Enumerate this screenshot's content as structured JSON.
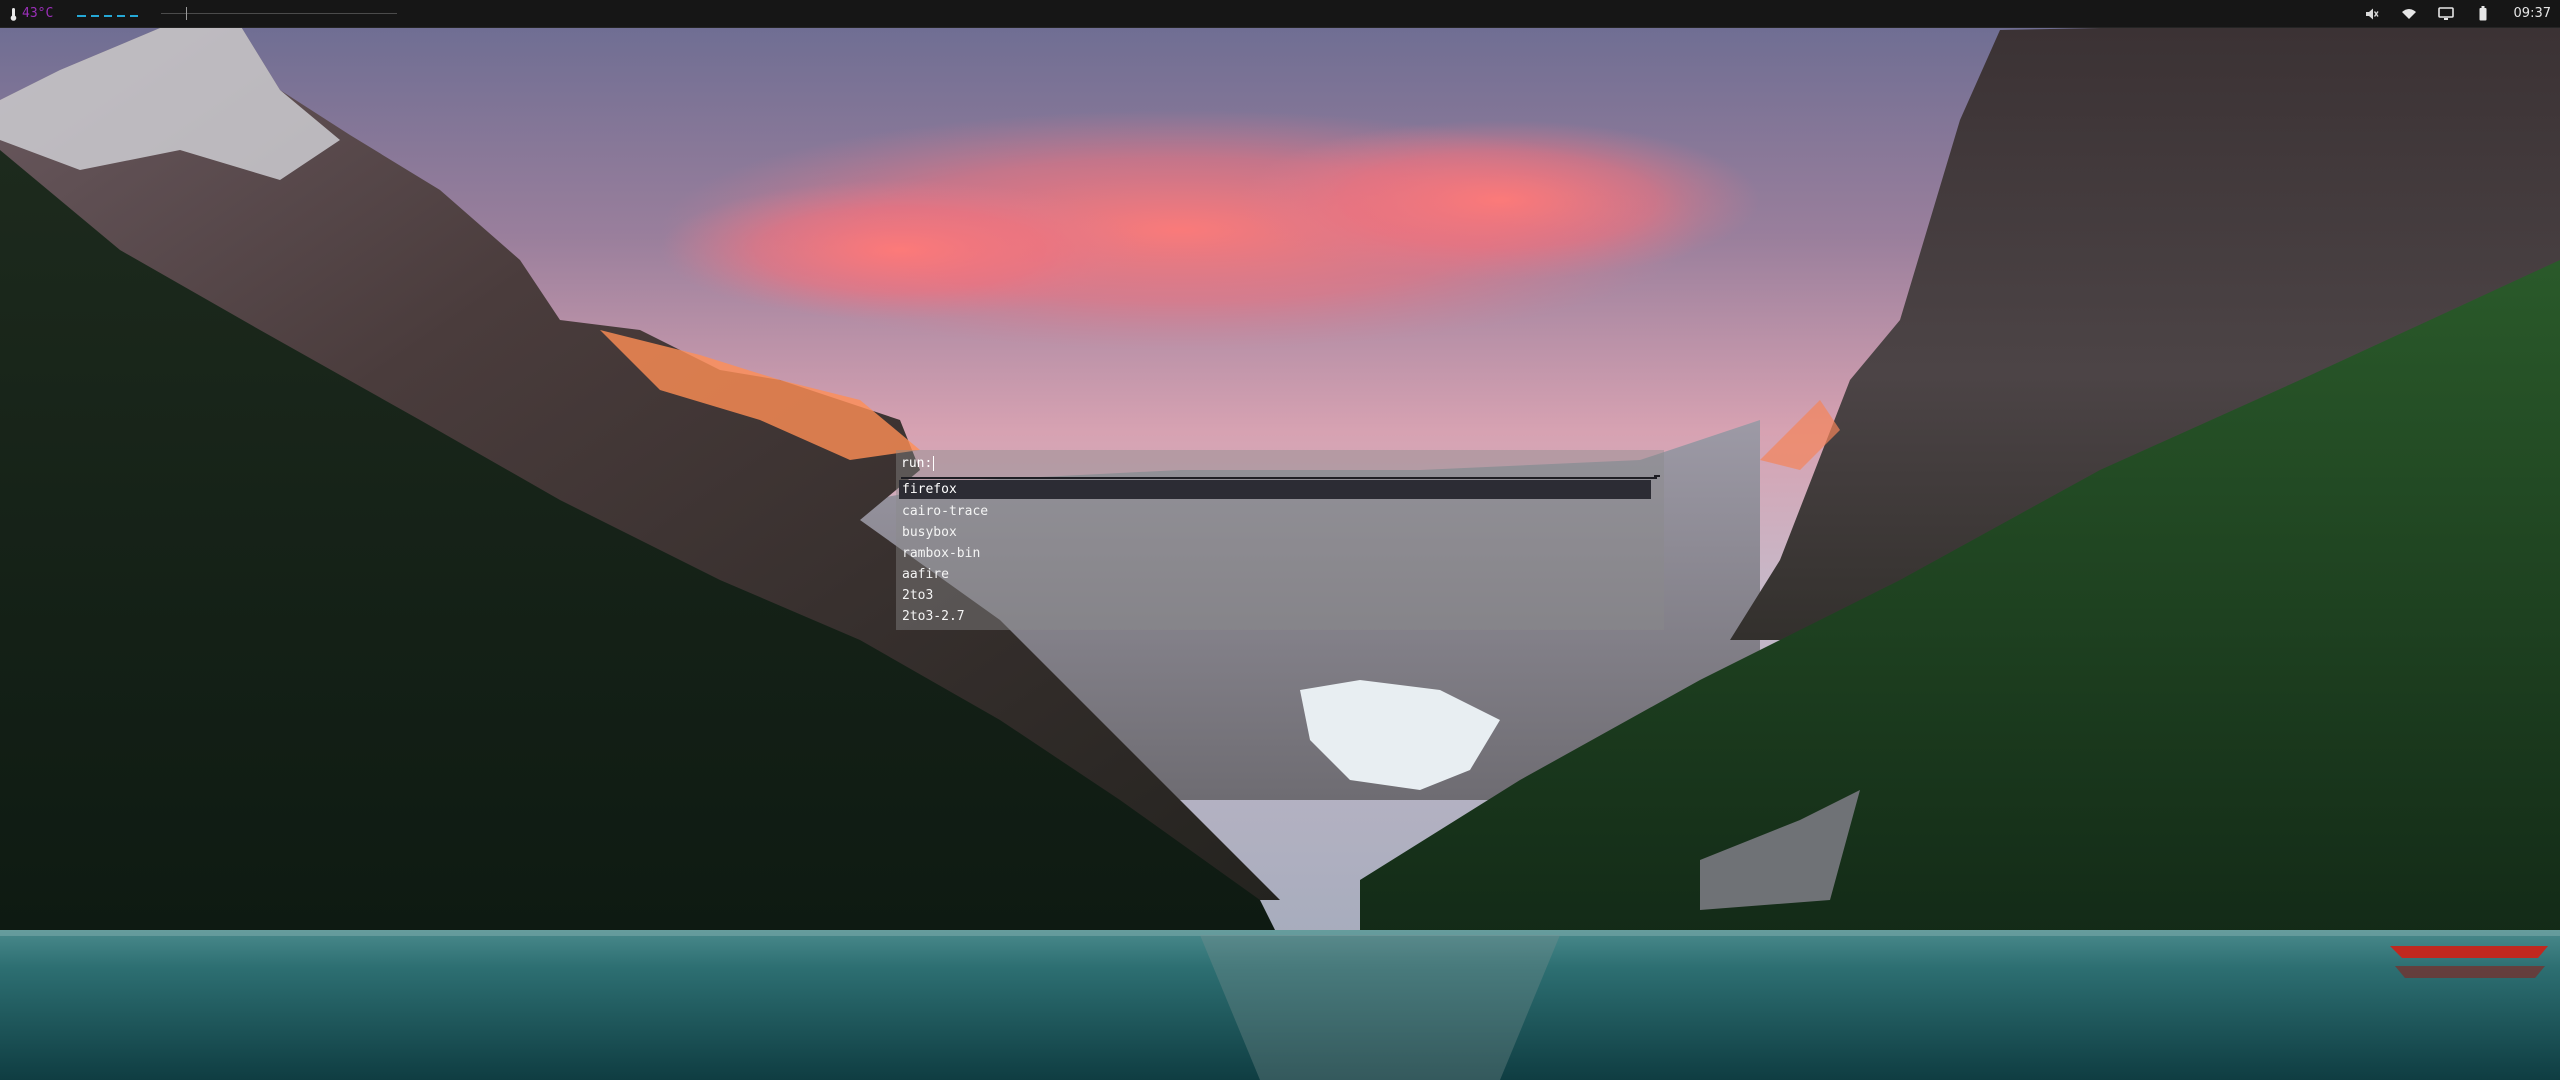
{
  "panel": {
    "temperature": "43°C",
    "workspaces": [
      "ws1",
      "ws2",
      "ws3",
      "ws4",
      "ws5"
    ],
    "tray": [
      {
        "name": "mute-icon"
      },
      {
        "name": "wifi-icon"
      },
      {
        "name": "display-icon"
      },
      {
        "name": "battery-icon"
      }
    ],
    "clock": "09:37"
  },
  "launcher": {
    "prompt": "run:",
    "input_value": "",
    "items": [
      "firefox",
      "cairo-trace",
      "busybox",
      "rambox-bin",
      "aafire",
      "2to3",
      "2to3-2.7"
    ],
    "selected_index": 0
  },
  "colors": {
    "panel_bg": "#161616",
    "workspace_accent": "#25a8d6",
    "temperature_text": "#9a2fb8",
    "selection_bg": "#2c2c34"
  }
}
